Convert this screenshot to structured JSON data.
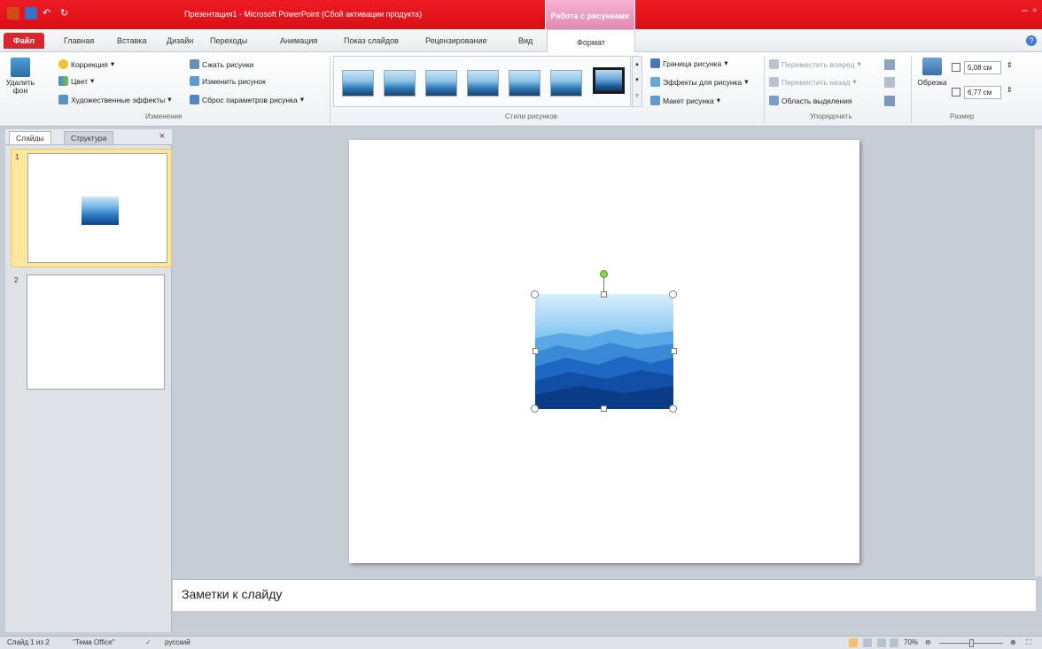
{
  "titlebar": {
    "document_title": "Презентация1  -  Microsoft PowerPoint (Сбой активации продукта)",
    "context_tab_group": "Работа с рисунками"
  },
  "tabs": {
    "file": "Файл",
    "home": "Главная",
    "insert": "Вставка",
    "design": "Дизайн",
    "transitions": "Переходы",
    "animation": "Анимация",
    "slideshow": "Показ слайдов",
    "review": "Рецензирование",
    "view": "Вид",
    "format": "Формат"
  },
  "ribbon": {
    "remove_bg": "Удалить фон",
    "correction": "Коррекция",
    "color": "Цвет",
    "art_effects": "Художественные эффекты",
    "compress": "Сжать рисунки",
    "change_picture": "Изменить рисунок",
    "reset_picture": "Сброс параметров рисунка",
    "group_adjust": "Изменение",
    "picture_border": "Граница рисунка",
    "picture_effects": "Эффекты для рисунка",
    "picture_layout": "Макет рисунка",
    "group_styles": "Стили рисунков",
    "bring_forward": "Переместить вперед",
    "send_backward": "Переместить назад",
    "selection_pane": "Область выделения",
    "group_arrange": "Упорядочить",
    "crop": "Обрезка",
    "height": "5,08 см",
    "width": "6,77 см",
    "group_size": "Размер"
  },
  "slides_panel": {
    "tab_slides": "Слайды",
    "tab_outline": "Структура",
    "close": "×",
    "slide1_num": "1",
    "slide2_num": "2"
  },
  "notes": {
    "placeholder": "Заметки к слайду"
  },
  "statusbar": {
    "slide_info": "Слайд 1 из 2",
    "theme": "\"Тема Office\"",
    "language": "русский",
    "zoom": "70%"
  },
  "colors": {
    "titlebar": "#e31b23",
    "context_tab": "#e79ac0",
    "slide_bg": "#ffffff",
    "workspace": "#c7cdd4"
  }
}
